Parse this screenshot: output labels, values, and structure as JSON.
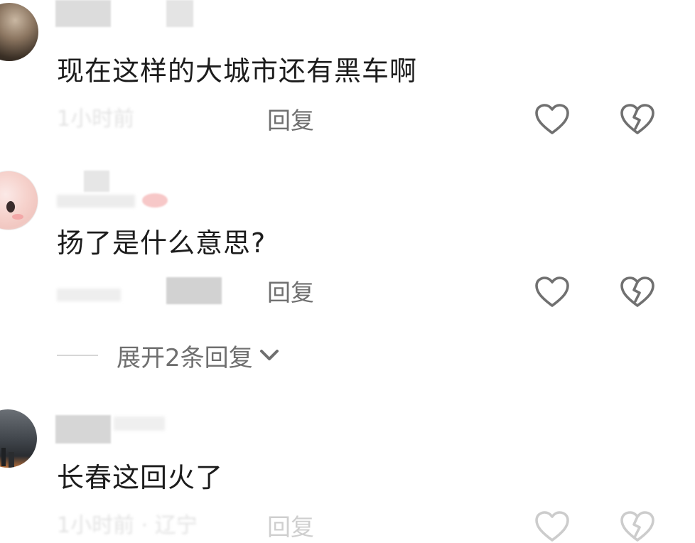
{
  "comments": [
    {
      "text": "现在这样的大城市还有黑车啊",
      "reply_label": "回复",
      "meta_faded": "1小时前"
    },
    {
      "text": "扬了是什么意思?",
      "reply_label": "回复",
      "expand_label": "展开2条回复"
    },
    {
      "text": "长春这回火了",
      "reply_label": "回复",
      "meta_faded": "1小时前 · 辽宁"
    }
  ],
  "icons": {
    "like": "heart-outline-icon",
    "dislike": "broken-heart-icon",
    "expand": "chevron-down-icon"
  },
  "colors": {
    "text": "#1c1c1c",
    "secondary": "#6f6f6f",
    "icon": "#707070"
  }
}
